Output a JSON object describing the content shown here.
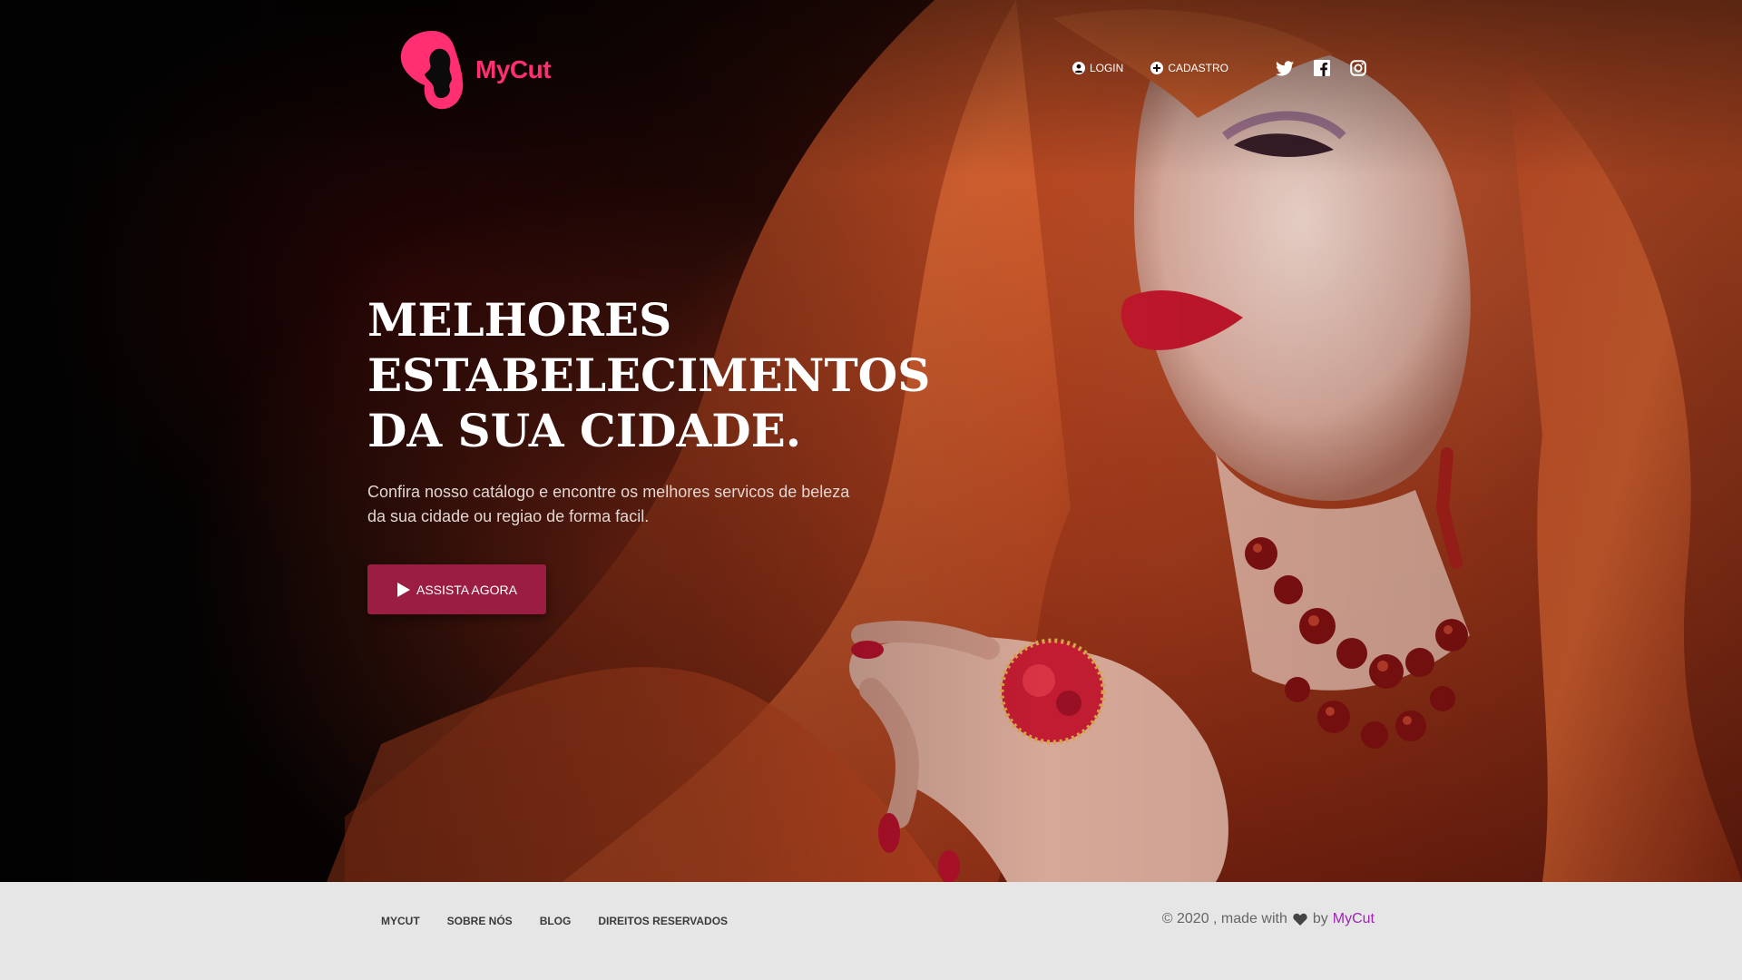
{
  "colors": {
    "brand": "#ff2f71",
    "cta": "#9b1d42",
    "footer_bg": "#e7e6e7",
    "footer_link": "#9c27b0"
  },
  "header": {
    "brand_name": "MyCut",
    "nav": [
      {
        "label": "LOGIN",
        "icon": "user-circle-icon"
      },
      {
        "label": "CADASTRO",
        "icon": "plus-circle-icon"
      }
    ],
    "social": [
      "twitter-icon",
      "facebook-icon",
      "instagram-icon"
    ]
  },
  "hero": {
    "headline_lines": [
      "MELHORES",
      "ESTABELECIMENTOS",
      "DA SUA CIDADE."
    ],
    "subtitle_lines": [
      "Confira nosso catálogo e encontre os melhores servicos de beleza",
      "da sua cidade ou regiao de forma facil."
    ],
    "cta_label": "ASSISTA AGORA"
  },
  "footer": {
    "links": [
      "MYCUT",
      "SOBRE NÓS",
      "BLOG",
      "DIREITOS RESERVADOS"
    ],
    "copyright_prefix": "© 2020 , made with",
    "copyright_by": "by",
    "copyright_brand": "MyCut"
  }
}
